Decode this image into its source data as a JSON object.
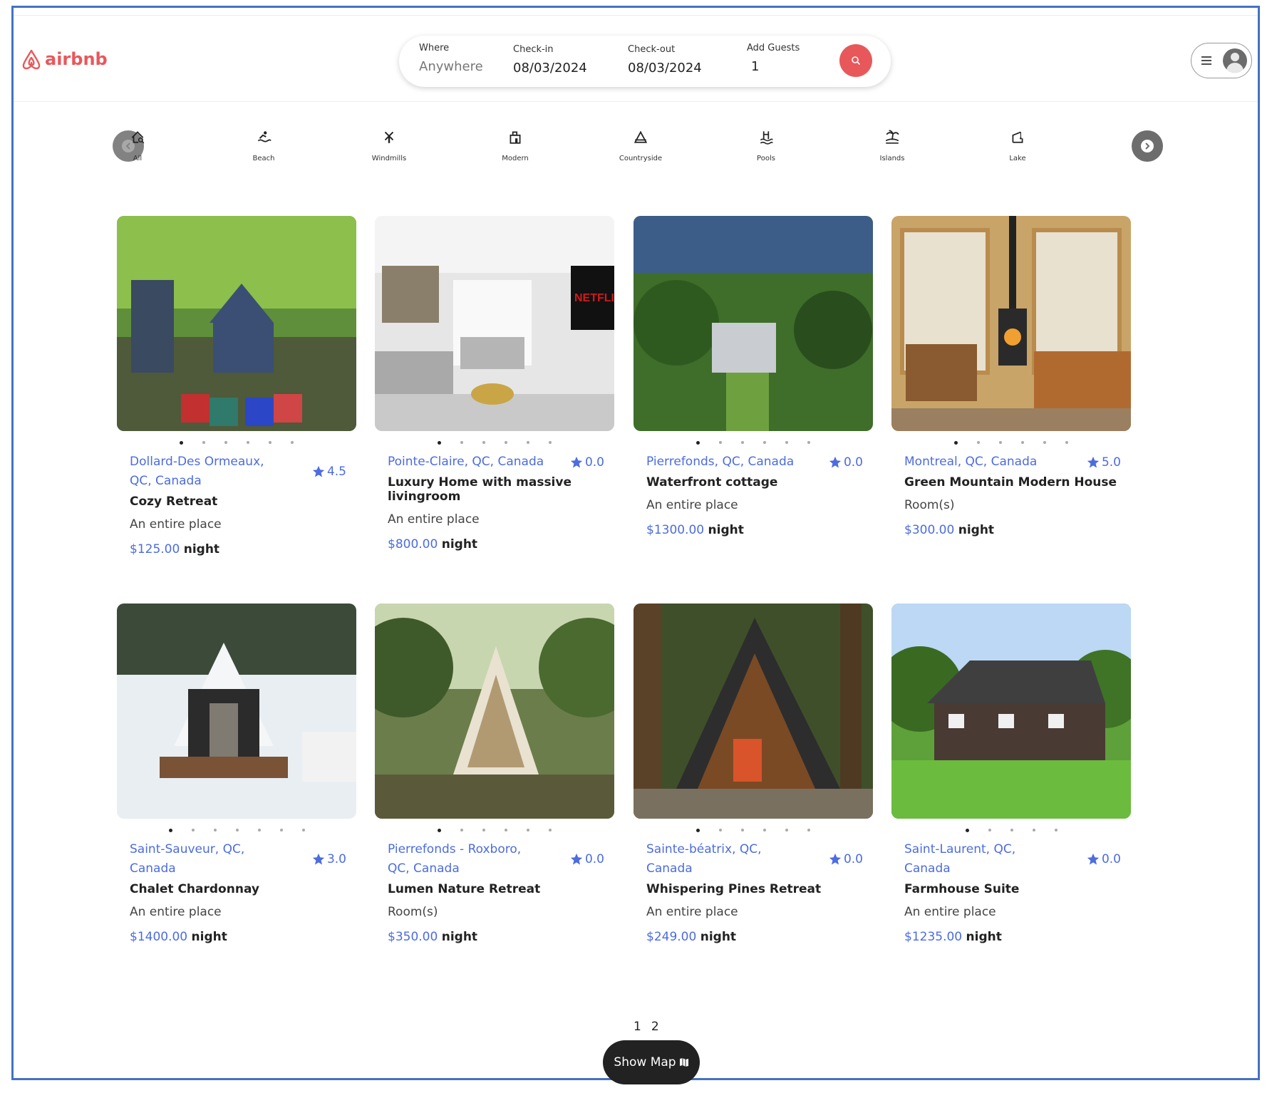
{
  "brand": {
    "name": "airbnb",
    "color": "#e8585b"
  },
  "search": {
    "where_label": "Where",
    "where_placeholder": "Anywhere",
    "checkin_label": "Check-in",
    "checkin_value": "08/03/2024",
    "checkout_label": "Check-out",
    "checkout_value": "08/03/2024",
    "guests_label": "Add Guests",
    "guests_value": "1"
  },
  "categories": [
    {
      "label": "All",
      "icon": "home-search-icon"
    },
    {
      "label": "Beach",
      "icon": "swimmer-icon"
    },
    {
      "label": "Windmills",
      "icon": "windmill-icon"
    },
    {
      "label": "Modern",
      "icon": "building-icon"
    },
    {
      "label": "Countryside",
      "icon": "tent-icon"
    },
    {
      "label": "Pools",
      "icon": "pool-icon"
    },
    {
      "label": "Islands",
      "icon": "island-icon"
    },
    {
      "label": "Lake",
      "icon": "fishing-icon"
    }
  ],
  "listings": [
    {
      "location": "Dollard-Des Ormeaux, QC, Canada",
      "rating": "4.5",
      "title": "Cozy Retreat",
      "type": "An entire place",
      "price": "$125.00",
      "per": "night",
      "dots": 6
    },
    {
      "location": "Pointe-Claire, QC, Canada",
      "rating": "0.0",
      "title": "Luxury Home with massive livingroom",
      "type": "An entire place",
      "price": "$800.00",
      "per": "night",
      "dots": 6
    },
    {
      "location": "Pierrefonds, QC, Canada",
      "rating": "0.0",
      "title": "Waterfront cottage",
      "type": "An entire place",
      "price": "$1300.00",
      "per": "night",
      "dots": 6
    },
    {
      "location": "Montreal, QC, Canada",
      "rating": "5.0",
      "title": "Green Mountain Modern House",
      "type": "Room(s)",
      "price": "$300.00",
      "per": "night",
      "dots": 6
    },
    {
      "location": "Saint-Sauveur, QC, Canada",
      "rating": "3.0",
      "title": "Chalet Chardonnay",
      "type": "An entire place",
      "price": "$1400.00",
      "per": "night",
      "dots": 7
    },
    {
      "location": "Pierrefonds - Roxboro, QC, Canada",
      "rating": "0.0",
      "title": "Lumen Nature Retreat",
      "type": "Room(s)",
      "price": "$350.00",
      "per": "night",
      "dots": 6
    },
    {
      "location": "Sainte-béatrix, QC, Canada",
      "rating": "0.0",
      "title": "Whispering Pines Retreat",
      "type": "An entire place",
      "price": "$249.00",
      "per": "night",
      "dots": 6
    },
    {
      "location": "Saint-Laurent, QC, Canada",
      "rating": "0.0",
      "title": "Farmhouse Suite",
      "type": "An entire place",
      "price": "$1235.00",
      "per": "night",
      "dots": 5
    }
  ],
  "pagination": [
    "1",
    "2"
  ],
  "show_map_label": "Show Map"
}
